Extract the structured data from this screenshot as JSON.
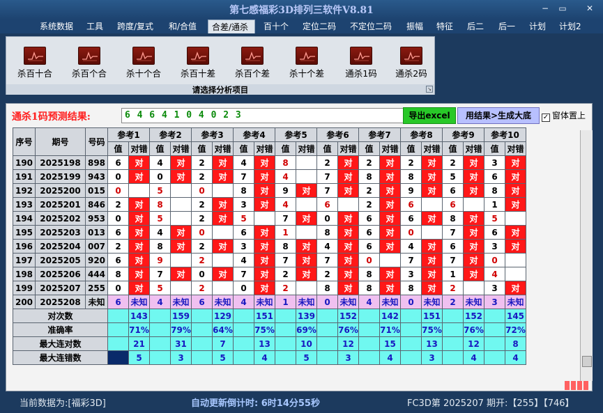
{
  "app": {
    "title": "第七感福彩3D排列三软件V8.81"
  },
  "window_controls": [
    "−",
    "▭",
    "✕"
  ],
  "menu": [
    "系统数据",
    "工具",
    "跨度/复式",
    "和/合值",
    "合差/通杀",
    "百十个",
    "定位二码",
    "不定位二码",
    "振幅",
    "特征",
    "后二",
    "后一",
    "计划",
    "计划2"
  ],
  "menu_active_index": 4,
  "ribbon": {
    "buttons": [
      "杀百十合",
      "杀百个合",
      "杀十个合",
      "杀百十差",
      "杀百个差",
      "杀十个差",
      "通杀1码",
      "通杀2码"
    ],
    "caption": "请选择分析项目",
    "icon": "chart-line-icon"
  },
  "result": {
    "label": "通杀1码预测结果:",
    "value": "6 4 6 4 1 0 4 0 2 3",
    "export_button": "导出excel",
    "generate_button": "用结果>生成大底",
    "topmost_label": "窗体置上",
    "topmost_checked": "✓"
  },
  "table": {
    "headers": [
      "序号",
      "期号",
      "号码"
    ],
    "ref_headers": [
      "参考1",
      "参考2",
      "参考3",
      "参考4",
      "参考5",
      "参考6",
      "参考7",
      "参考8",
      "参考9",
      "参考10"
    ],
    "sub_val": "值",
    "sub_hit": "对错",
    "hit_text": "对",
    "rows": [
      {
        "seq": "190",
        "issue": "2025198",
        "num": "898",
        "cells": [
          [
            "6",
            "h"
          ],
          [
            "4",
            "h"
          ],
          [
            "2",
            "h"
          ],
          [
            "4",
            "h"
          ],
          [
            "8",
            "m"
          ],
          [
            "2",
            "h"
          ],
          [
            "2",
            "h"
          ],
          [
            "2",
            "h"
          ],
          [
            "2",
            "h"
          ],
          [
            "3",
            "h"
          ]
        ]
      },
      {
        "seq": "191",
        "issue": "2025199",
        "num": "943",
        "cells": [
          [
            "0",
            "h"
          ],
          [
            "0",
            "h"
          ],
          [
            "2",
            "h"
          ],
          [
            "7",
            "h"
          ],
          [
            "4",
            "m"
          ],
          [
            "7",
            "h"
          ],
          [
            "8",
            "h"
          ],
          [
            "8",
            "h"
          ],
          [
            "5",
            "h"
          ],
          [
            "6",
            "h"
          ]
        ]
      },
      {
        "seq": "192",
        "issue": "2025200",
        "num": "015",
        "cells": [
          [
            "0",
            "m"
          ],
          [
            "5",
            "m"
          ],
          [
            "0",
            "m"
          ],
          [
            "8",
            "h"
          ],
          [
            "9",
            "h"
          ],
          [
            "7",
            "h"
          ],
          [
            "2",
            "h"
          ],
          [
            "9",
            "h"
          ],
          [
            "6",
            "h"
          ],
          [
            "8",
            "h"
          ]
        ]
      },
      {
        "seq": "193",
        "issue": "2025201",
        "num": "846",
        "cells": [
          [
            "2",
            "h"
          ],
          [
            "8",
            "m"
          ],
          [
            "2",
            "h"
          ],
          [
            "3",
            "h"
          ],
          [
            "4",
            "m"
          ],
          [
            "6",
            "m"
          ],
          [
            "2",
            "h"
          ],
          [
            "6",
            "m"
          ],
          [
            "6",
            "m"
          ],
          [
            "1",
            "h"
          ]
        ]
      },
      {
        "seq": "194",
        "issue": "2025202",
        "num": "953",
        "cells": [
          [
            "0",
            "h"
          ],
          [
            "5",
            "m"
          ],
          [
            "2",
            "h"
          ],
          [
            "5",
            "m"
          ],
          [
            "7",
            "h"
          ],
          [
            "0",
            "h"
          ],
          [
            "6",
            "h"
          ],
          [
            "6",
            "h"
          ],
          [
            "8",
            "h"
          ],
          [
            "5",
            "m"
          ]
        ]
      },
      {
        "seq": "195",
        "issue": "2025203",
        "num": "013",
        "cells": [
          [
            "6",
            "h"
          ],
          [
            "4",
            "h"
          ],
          [
            "0",
            "m"
          ],
          [
            "6",
            "h"
          ],
          [
            "1",
            "m"
          ],
          [
            "8",
            "h"
          ],
          [
            "6",
            "h"
          ],
          [
            "0",
            "m"
          ],
          [
            "7",
            "h"
          ],
          [
            "6",
            "h"
          ]
        ]
      },
      {
        "seq": "196",
        "issue": "2025204",
        "num": "007",
        "cells": [
          [
            "2",
            "h"
          ],
          [
            "8",
            "h"
          ],
          [
            "2",
            "h"
          ],
          [
            "3",
            "h"
          ],
          [
            "8",
            "h"
          ],
          [
            "4",
            "h"
          ],
          [
            "6",
            "h"
          ],
          [
            "4",
            "h"
          ],
          [
            "6",
            "h"
          ],
          [
            "3",
            "h"
          ]
        ]
      },
      {
        "seq": "197",
        "issue": "2025205",
        "num": "920",
        "cells": [
          [
            "6",
            "h"
          ],
          [
            "9",
            "m"
          ],
          [
            "2",
            "m"
          ],
          [
            "4",
            "h"
          ],
          [
            "7",
            "h"
          ],
          [
            "7",
            "h"
          ],
          [
            "0",
            "m"
          ],
          [
            "7",
            "h"
          ],
          [
            "7",
            "h"
          ],
          [
            "0",
            "m"
          ]
        ]
      },
      {
        "seq": "198",
        "issue": "2025206",
        "num": "444",
        "cells": [
          [
            "8",
            "h"
          ],
          [
            "7",
            "h"
          ],
          [
            "0",
            "h"
          ],
          [
            "7",
            "h"
          ],
          [
            "2",
            "h"
          ],
          [
            "2",
            "h"
          ],
          [
            "8",
            "h"
          ],
          [
            "3",
            "h"
          ],
          [
            "1",
            "h"
          ],
          [
            "4",
            "m"
          ]
        ]
      },
      {
        "seq": "199",
        "issue": "2025207",
        "num": "255",
        "cells": [
          [
            "0",
            "h"
          ],
          [
            "5",
            "m"
          ],
          [
            "2",
            "m"
          ],
          [
            "0",
            "h"
          ],
          [
            "2",
            "m"
          ],
          [
            "8",
            "h"
          ],
          [
            "8",
            "h"
          ],
          [
            "8",
            "h"
          ],
          [
            "2",
            "m"
          ],
          [
            "3",
            "h"
          ]
        ]
      }
    ],
    "last_row": {
      "seq": "200",
      "issue": "2025208",
      "num": "未知",
      "vals": [
        "6",
        "4",
        "6",
        "4",
        "1",
        "0",
        "4",
        "0",
        "2",
        "3"
      ],
      "unknown": "未知"
    },
    "stats": [
      {
        "label": "对次数",
        "vals": [
          "143",
          "159",
          "129",
          "151",
          "139",
          "152",
          "142",
          "151",
          "152",
          "145"
        ]
      },
      {
        "label": "准确率",
        "vals": [
          "71%",
          "79%",
          "64%",
          "75%",
          "69%",
          "76%",
          "71%",
          "75%",
          "76%",
          "72%"
        ]
      },
      {
        "label": "最大连对数",
        "vals": [
          "21",
          "31",
          "7",
          "13",
          "10",
          "12",
          "15",
          "13",
          "12",
          "8"
        ]
      },
      {
        "label": "最大连错数",
        "vals": [
          "5",
          "3",
          "5",
          "4",
          "5",
          "3",
          "4",
          "3",
          "4",
          "4"
        ]
      }
    ]
  },
  "status": {
    "current": "当前数据为:[福彩3D]",
    "countdown": "自动更新倒计时: 6时14分55秒",
    "issue_info": "FC3D第 2025207 期开:【255】【746】"
  }
}
